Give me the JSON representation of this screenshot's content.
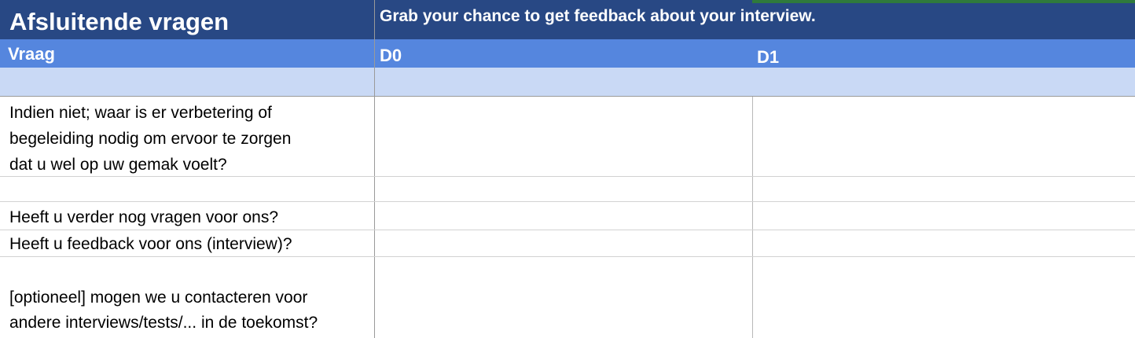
{
  "header": {
    "title": "Afsluitende vragen",
    "subtitle": "Grab your chance to get feedback about your interview."
  },
  "columns": {
    "a": "Vraag",
    "b": "D0",
    "c": "D1"
  },
  "rows": [
    {
      "question": "Indien niet; waar is er verbetering of begeleiding nodig om ervoor te zorgen dat u wel op uw gemak voelt?",
      "lines": [
        "Indien niet; waar is er verbetering of",
        "begeleiding nodig om ervoor te zorgen",
        "dat u wel op uw gemak voelt?"
      ]
    },
    {
      "question": ""
    },
    {
      "question": "Heeft u verder nog vragen voor ons?"
    },
    {
      "question": "Heeft u feedback voor ons (interview)?"
    },
    {
      "question": "[optioneel] mogen we u contacteren voor andere interviews/tests/... in de toekomst?",
      "lines": [
        "[optioneel] mogen we u contacteren voor",
        "andere interviews/tests/... in de toekomst?"
      ]
    }
  ],
  "colors": {
    "title_bg": "#284884",
    "column_header_bg": "#5586DE",
    "light_row_bg": "#C9D9F5",
    "accent_green": "#2F7A3C"
  }
}
